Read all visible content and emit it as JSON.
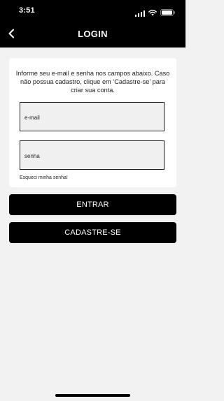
{
  "status_bar": {
    "time": "3:51"
  },
  "nav": {
    "title": "LOGIN",
    "back_icon": "chevron-left-icon"
  },
  "card": {
    "info_text": "Informe seu e-mail e senha nos campos abaixo. Caso não possua cadastro, clique em ‘Cadastre-se’ para criar sua conta.",
    "email_placeholder": "e-mail",
    "password_placeholder": "senha",
    "forgot_password": "Esqueci minha senha!"
  },
  "buttons": {
    "login_label": "ENTRAR",
    "signup_label": "CADASTRE-SE"
  },
  "colors": {
    "primary": "#000000",
    "background": "#f2f2f2",
    "card": "#ffffff"
  }
}
